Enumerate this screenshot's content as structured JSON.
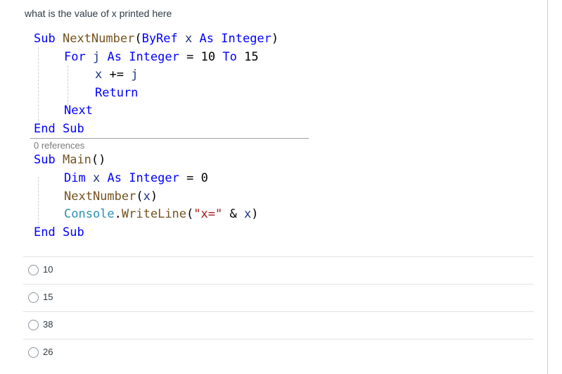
{
  "question": {
    "text": "what is the value of x printed here"
  },
  "code": {
    "sub1": {
      "line1": {
        "sub_kw": "Sub",
        "name": "NextNumber",
        "open": "(",
        "byref_kw": "ByRef",
        "param": "x",
        "as_kw": "As",
        "type_kw": "Integer",
        "close": ")"
      },
      "line2": {
        "for_kw": "For",
        "var": "j",
        "as_kw": "As",
        "type_kw": "Integer",
        "eq": "=",
        "start": "10",
        "to_kw": "To",
        "end": "15"
      },
      "line3": {
        "var": "x",
        "op": "+=",
        "var2": "j"
      },
      "line4": {
        "return_kw": "Return"
      },
      "line5": {
        "next_kw": "Next"
      },
      "line6": {
        "end_kw": "End",
        "sub_kw": "Sub"
      }
    },
    "references": "0 references",
    "sub2": {
      "line1": {
        "sub_kw": "Sub",
        "name": "Main",
        "parens": "()"
      },
      "line2": {
        "dim_kw": "Dim",
        "var": "x",
        "as_kw": "As",
        "type_kw": "Integer",
        "eq": "=",
        "value": "0"
      },
      "line3": {
        "call": "NextNumber",
        "open": "(",
        "arg": "x",
        "close": ")"
      },
      "line4": {
        "cls": "Console",
        "dot": ".",
        "method": "WriteLine",
        "open": "(",
        "str": "\"x=\"",
        "amp": "&",
        "arg": "x",
        "close": ")"
      },
      "line5": {
        "end_kw": "End",
        "sub_kw": "Sub"
      }
    }
  },
  "answers": [
    {
      "label": "10"
    },
    {
      "label": "15"
    },
    {
      "label": "38"
    },
    {
      "label": "26"
    }
  ],
  "colors": {
    "keyword": "#0000ff",
    "method": "#74531f",
    "variable": "#1f377f",
    "type": "#2b91af",
    "string": "#a31515"
  }
}
